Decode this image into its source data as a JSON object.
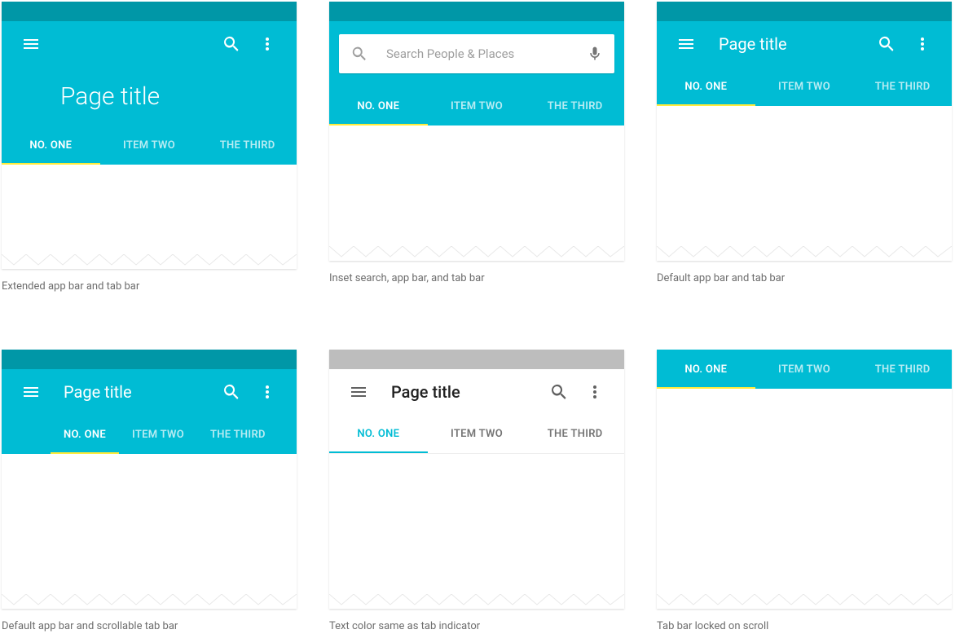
{
  "colors": {
    "primary": "#00bcd4",
    "primary_dark": "#0097a7",
    "accent_indicator": "#ffeb3b",
    "text_light": "#ffffff",
    "text_dark": "#212121",
    "caption": "#6d6d6d"
  },
  "cards": {
    "extended": {
      "title": "Page title",
      "tabs": [
        "NO. ONE",
        "ITEM TWO",
        "THE THIRD"
      ],
      "caption": "Extended app bar and tab bar"
    },
    "inset_search": {
      "search_placeholder": "Search People  & Places",
      "tabs": [
        "NO. ONE",
        "ITEM TWO",
        "THE THIRD"
      ],
      "caption": "Inset search, app bar, and tab bar"
    },
    "default": {
      "title": "Page title",
      "tabs": [
        "NO. ONE",
        "ITEM TWO",
        "THE THIRD"
      ],
      "caption": "Default app bar and tab bar"
    },
    "scrollable": {
      "title": "Page title",
      "tabs": [
        "NO. ONE",
        "ITEM TWO",
        "THE THIRD"
      ],
      "caption": "Default app bar and scrollable tab bar"
    },
    "light": {
      "title": "Page title",
      "tabs": [
        "NO. ONE",
        "ITEM TWO",
        "THE THIRD"
      ],
      "caption": "Text color same as tab indicator"
    },
    "locked": {
      "tabs": [
        "NO. ONE",
        "ITEM TWO",
        "THE THIRD"
      ],
      "caption": "Tab bar locked on scroll"
    }
  }
}
